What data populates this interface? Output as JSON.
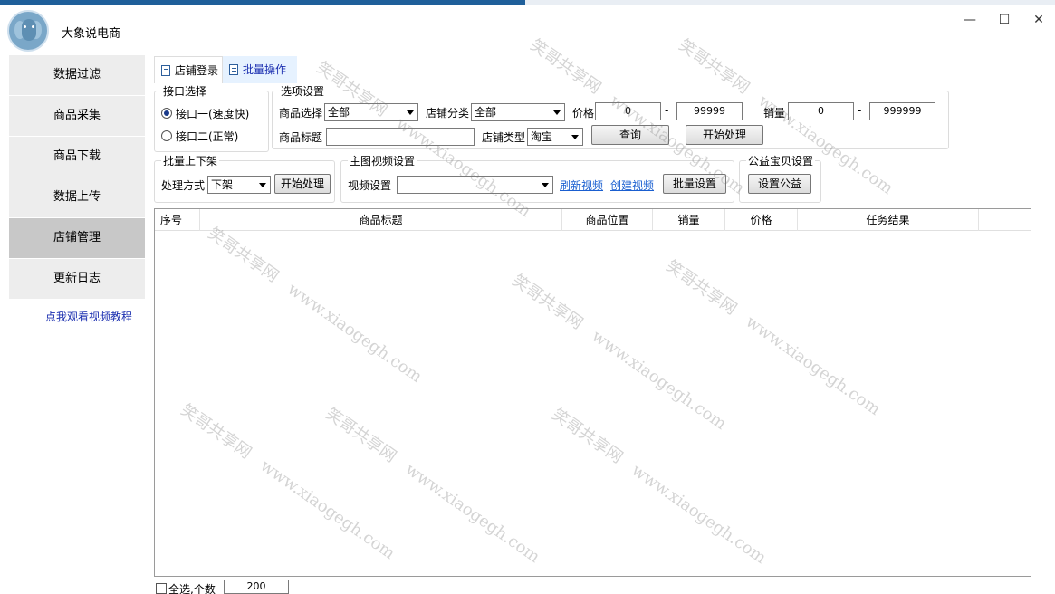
{
  "app": {
    "title": "大象说电商"
  },
  "window_controls": {
    "minimize": "—",
    "maximize": "☐",
    "close": "✕"
  },
  "sidebar": {
    "items": [
      {
        "label": "数据过滤"
      },
      {
        "label": "商品采集"
      },
      {
        "label": "商品下载"
      },
      {
        "label": "数据上传"
      },
      {
        "label": "店铺管理",
        "active": true
      },
      {
        "label": "更新日志"
      }
    ],
    "tutorial_link": "点我观看视频教程"
  },
  "tabs": [
    {
      "label": "店铺登录"
    },
    {
      "label": "批量操作",
      "active": true
    }
  ],
  "interface": {
    "legend": "接口选择",
    "option1": "接口一(速度快)",
    "option2": "接口二(正常)",
    "selected": 1
  },
  "options": {
    "legend": "选项设置",
    "product_select_label": "商品选择",
    "product_select_value": "全部",
    "shop_category_label": "店铺分类",
    "shop_category_value": "全部",
    "price_label": "价格",
    "price_min": "0",
    "price_max": "99999",
    "sales_label": "销量",
    "sales_min": "0",
    "sales_max": "999999",
    "dash": "-",
    "product_title_label": "商品标题",
    "product_title_value": "",
    "shop_type_label": "店铺类型",
    "shop_type_value": "淘宝",
    "query_button": "查询",
    "start_button": "开始处理"
  },
  "batch_shelf": {
    "legend": "批量上下架",
    "method_label": "处理方式",
    "method_value": "下架",
    "start_button": "开始处理"
  },
  "video": {
    "legend": "主图视频设置",
    "video_label": "视频设置",
    "video_value": "",
    "refresh_link": "刷新视频",
    "create_link": "创建视频",
    "batch_button": "批量设置"
  },
  "charity": {
    "legend": "公益宝贝设置",
    "button": "设置公益"
  },
  "table": {
    "columns": [
      "序号",
      "商品标题",
      "商品位置",
      "销量",
      "价格",
      "任务结果"
    ],
    "rows": []
  },
  "footer": {
    "select_all_label": "全选,个数",
    "count_value": "200"
  },
  "watermark": {
    "line1": "笑哥共享网",
    "line2": "www.xiaogegh.com"
  }
}
